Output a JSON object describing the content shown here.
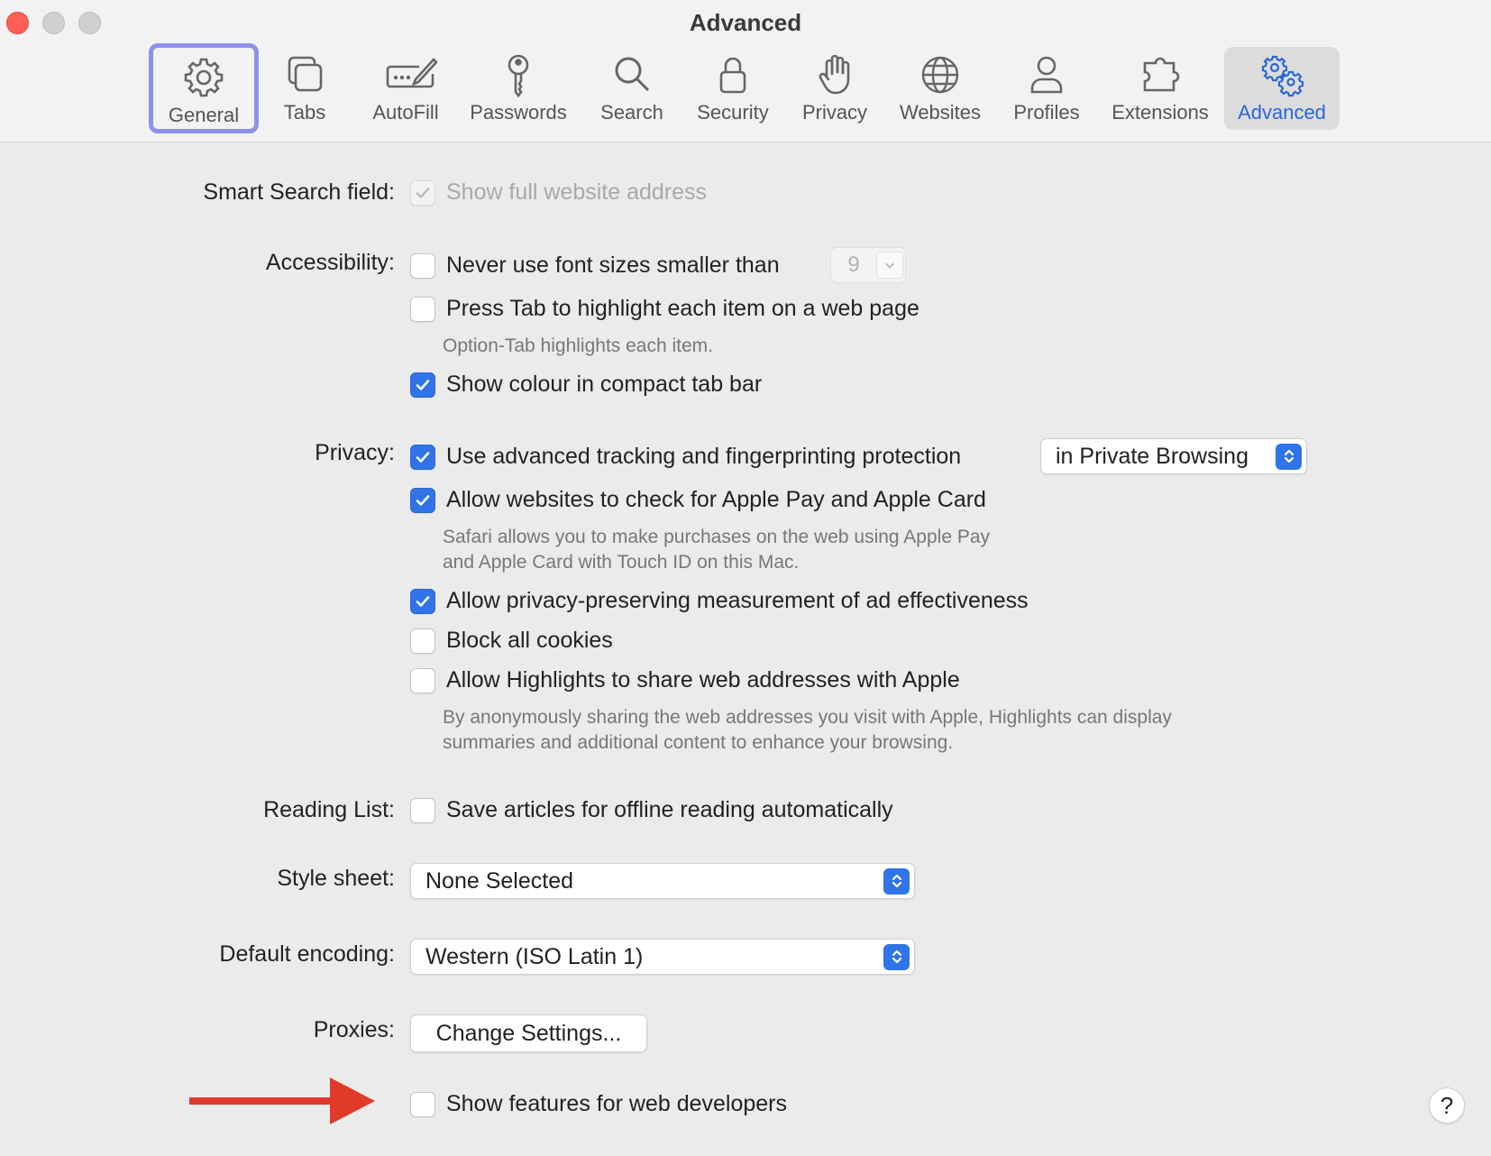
{
  "window": {
    "title": "Advanced"
  },
  "tabs": [
    {
      "id": "general",
      "label": "General",
      "icon": "gear-icon"
    },
    {
      "id": "tabs",
      "label": "Tabs",
      "icon": "tabs-icon"
    },
    {
      "id": "autofill",
      "label": "AutoFill",
      "icon": "autofill-icon"
    },
    {
      "id": "passwords",
      "label": "Passwords",
      "icon": "key-icon"
    },
    {
      "id": "search",
      "label": "Search",
      "icon": "search-icon"
    },
    {
      "id": "security",
      "label": "Security",
      "icon": "lock-icon"
    },
    {
      "id": "privacy",
      "label": "Privacy",
      "icon": "hand-icon"
    },
    {
      "id": "websites",
      "label": "Websites",
      "icon": "globe-icon"
    },
    {
      "id": "profiles",
      "label": "Profiles",
      "icon": "person-icon"
    },
    {
      "id": "extensions",
      "label": "Extensions",
      "icon": "puzzle-icon"
    },
    {
      "id": "advanced",
      "label": "Advanced",
      "icon": "gears-icon",
      "selected": true
    }
  ],
  "sections": {
    "smart_search": {
      "label": "Smart Search field:",
      "options": [
        {
          "label": "Show full website address",
          "checked": true,
          "disabled": true
        }
      ]
    },
    "accessibility": {
      "label": "Accessibility:",
      "font_size_option": "Never use font sizes smaller than",
      "font_size_value": "9",
      "tab_option": "Press Tab to highlight each item on a web page",
      "tab_note": "Option-Tab highlights each item.",
      "colour_option": "Show colour in compact tab bar",
      "font_size_checked": false,
      "tab_checked": false,
      "colour_checked": true
    },
    "privacy": {
      "label": "Privacy:",
      "tracking_option": "Use advanced tracking and fingerprinting protection",
      "tracking_scope": "in Private Browsing",
      "applepay_option": "Allow websites to check for Apple Pay and Apple Card",
      "applepay_note_1": "Safari allows you to make purchases on the web using Apple Pay",
      "applepay_note_2": "and Apple Card with Touch ID on this Mac.",
      "ad_option": "Allow privacy-preserving measurement of ad effectiveness",
      "cookies_option": "Block all cookies",
      "highlights_option": "Allow Highlights to share web addresses with Apple",
      "highlights_note_1": "By anonymously sharing the web addresses you visit with Apple, Highlights can display",
      "highlights_note_2": "summaries and additional content to enhance your browsing."
    },
    "reading_list": {
      "label": "Reading List:",
      "option": "Save articles for offline reading automatically"
    },
    "style_sheet": {
      "label": "Style sheet:",
      "value": "None Selected"
    },
    "encoding": {
      "label": "Default encoding:",
      "value": "Western (ISO Latin 1)"
    },
    "proxies": {
      "label": "Proxies:",
      "button": "Change Settings..."
    },
    "developer": {
      "option": "Show features for web developers"
    }
  },
  "help_label": "?",
  "colors": {
    "accent": "#2f74e8",
    "arrow": "#e23a2a",
    "focus_ring": "#8c92ea"
  }
}
